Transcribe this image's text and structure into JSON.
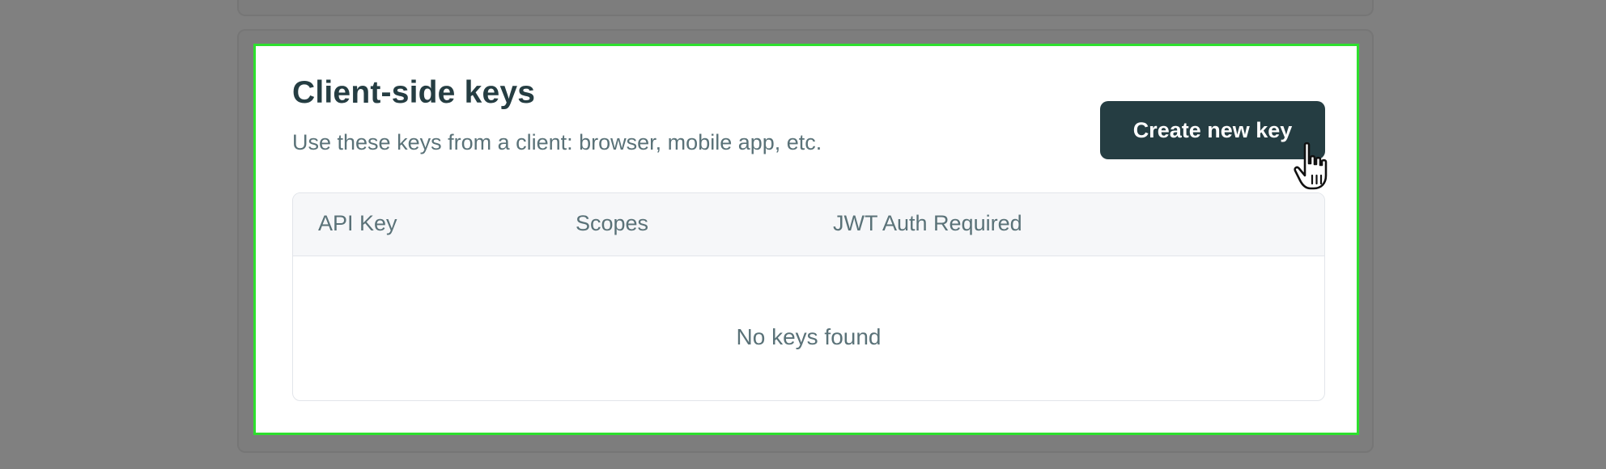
{
  "section": {
    "title": "Client-side keys",
    "subtitle": "Use these keys from a client: browser, mobile app, etc.",
    "create_button_label": "Create new key"
  },
  "table": {
    "columns": [
      "API Key",
      "Scopes",
      "JWT Auth Required"
    ],
    "empty_message": "No keys found"
  },
  "icons": {
    "cursor": "hand-pointer-icon"
  },
  "colors": {
    "primary": "#253d42",
    "highlight_border": "#2ddf2d",
    "muted_text": "#5a7278",
    "overlay": "#808080"
  }
}
